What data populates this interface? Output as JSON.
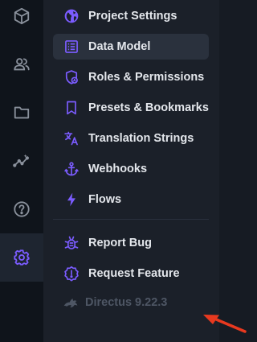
{
  "colors": {
    "accent": "#7b5cff",
    "text": "#e4e7ec",
    "muted": "#4e5664",
    "rail_icon": "#8a919c",
    "arrow": "#e8391f"
  },
  "rail": {
    "items": [
      {
        "name": "content",
        "icon": "cube-icon"
      },
      {
        "name": "users",
        "icon": "users-icon"
      },
      {
        "name": "files",
        "icon": "folder-icon"
      },
      {
        "name": "insights",
        "icon": "insights-icon"
      },
      {
        "name": "help",
        "icon": "help-icon"
      },
      {
        "name": "settings",
        "icon": "gear-icon",
        "active": true
      }
    ]
  },
  "nav": {
    "items": [
      {
        "label": "Project Settings",
        "icon": "globe-icon"
      },
      {
        "label": "Data Model",
        "icon": "list-icon",
        "active": true
      },
      {
        "label": "Roles & Permissions",
        "icon": "admin-shield-icon"
      },
      {
        "label": "Presets & Bookmarks",
        "icon": "bookmark-icon"
      },
      {
        "label": "Translation Strings",
        "icon": "translate-icon"
      },
      {
        "label": "Webhooks",
        "icon": "anchor-icon"
      },
      {
        "label": "Flows",
        "icon": "bolt-icon"
      }
    ],
    "footer": [
      {
        "label": "Report Bug",
        "icon": "bug-icon"
      },
      {
        "label": "Request Feature",
        "icon": "new-releases-icon"
      }
    ],
    "version": {
      "label": "Directus 9.22.3",
      "icon": "directus-logo-icon"
    }
  }
}
